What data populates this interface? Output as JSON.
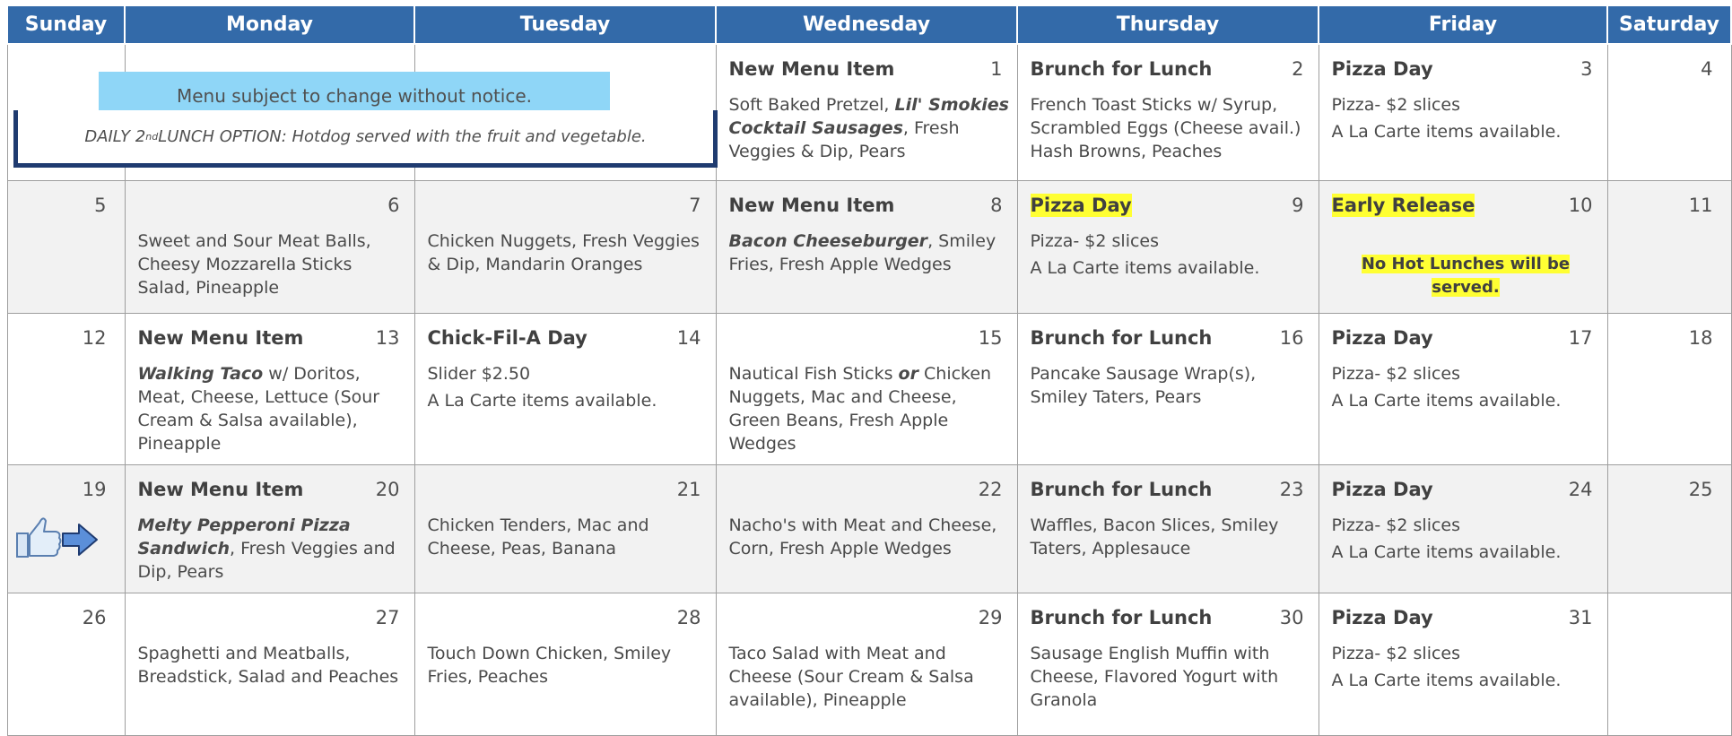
{
  "days": [
    "Sunday",
    "Monday",
    "Tuesday",
    "Wednesday",
    "Thursday",
    "Friday",
    "Saturday"
  ],
  "notice": "Menu subject to change without notice.",
  "daily_option": {
    "prefix": "DAILY 2",
    "sup": "nd",
    "suffix": " LUNCH OPTION: Hotdog served with the fruit and vegetable."
  },
  "icons": {
    "thumb": "thumbs-up-icon",
    "arrow": "right-arrow-icon"
  },
  "colors": {
    "header": "#336aa9",
    "highlight": "#ffff33",
    "notice": "#8fd6f7",
    "frame": "#1f3b70"
  },
  "weeks": [
    {
      "sun": {
        "num": ""
      },
      "mon": {
        "num": ""
      },
      "tue": {
        "num": ""
      },
      "wed": {
        "num": "1",
        "title": "New Menu Item",
        "b1": "Soft Baked Pretzel, ",
        "b2": "Lil' Smokies Cocktail Sausages",
        "b3": ", Fresh Veggies & Dip, Pears"
      },
      "thu": {
        "num": "2",
        "title": "Brunch for Lunch",
        "text": "French Toast Sticks w/ Syrup, Scrambled Eggs (Cheese avail.) Hash Browns, Peaches"
      },
      "fri": {
        "num": "3",
        "title": "Pizza Day",
        "l1": "Pizza- $2 slices",
        "l2": "A La Carte items available."
      },
      "sat": {
        "num": "4"
      }
    },
    {
      "sun": {
        "num": "5"
      },
      "mon": {
        "num": "6",
        "text": "Sweet and Sour Meat Balls, Cheesy Mozzarella Sticks Salad, Pineapple"
      },
      "tue": {
        "num": "7",
        "text": "Chicken Nuggets, Fresh Veggies & Dip, Mandarin Oranges"
      },
      "wed": {
        "num": "8",
        "title": "New Menu Item",
        "b1": "Bacon Cheeseburger",
        "b2": ", Smiley Fries, Fresh Apple Wedges"
      },
      "thu": {
        "num": "9",
        "title": "Pizza Day",
        "l1": "Pizza- $2 slices",
        "l2": "A La Carte items available."
      },
      "fri": {
        "num": "10",
        "title": "Early Release",
        "notice": "No Hot Lunches will be served."
      },
      "sat": {
        "num": "11"
      }
    },
    {
      "sun": {
        "num": "12"
      },
      "mon": {
        "num": "13",
        "title": "New Menu Item",
        "b1": "Walking Taco",
        "b2": " w/ Doritos, Meat, Cheese, Lettuce (Sour Cream & Salsa available), Pineapple"
      },
      "tue": {
        "num": "14",
        "title": "Chick-Fil-A Day",
        "l1": "Slider $2.50",
        "l2": "A La Carte items available."
      },
      "wed": {
        "num": "15",
        "t1": "Nautical Fish Sticks ",
        "or": "or",
        "t2": " Chicken Nuggets, Mac and Cheese, Green Beans, Fresh Apple Wedges"
      },
      "thu": {
        "num": "16",
        "title": "Brunch for Lunch",
        "text": "Pancake Sausage Wrap(s), Smiley Taters, Pears"
      },
      "fri": {
        "num": "17",
        "title": "Pizza Day",
        "l1": "Pizza- $2 slices",
        "l2": "A La Carte items available."
      },
      "sat": {
        "num": "18"
      }
    },
    {
      "sun": {
        "num": "19"
      },
      "mon": {
        "num": "20",
        "title": "New Menu Item",
        "b1": "Melty Pepperoni Pizza Sandwich",
        "b2": ", Fresh Veggies and Dip, Pears"
      },
      "tue": {
        "num": "21",
        "text": "Chicken Tenders, Mac and Cheese, Peas, Banana"
      },
      "wed": {
        "num": "22",
        "text": "Nacho's with Meat and Cheese, Corn, Fresh Apple Wedges"
      },
      "thu": {
        "num": "23",
        "title": "Brunch for Lunch",
        "text": "Waffles, Bacon Slices, Smiley Taters, Applesauce"
      },
      "fri": {
        "num": "24",
        "title": "Pizza Day",
        "l1": "Pizza- $2 slices",
        "l2": "A La Carte items available."
      },
      "sat": {
        "num": "25"
      }
    },
    {
      "sun": {
        "num": "26"
      },
      "mon": {
        "num": "27",
        "text": "Spaghetti and Meatballs, Breadstick, Salad and Peaches"
      },
      "tue": {
        "num": "28",
        "text": "Touch Down Chicken, Smiley Fries, Peaches"
      },
      "wed": {
        "num": "29",
        "text": "Taco Salad with Meat and Cheese (Sour Cream & Salsa available), Pineapple"
      },
      "thu": {
        "num": "30",
        "title": "Brunch for Lunch",
        "text": "Sausage English Muffin with Cheese, Flavored Yogurt with Granola"
      },
      "fri": {
        "num": "31",
        "title": "Pizza Day",
        "l1": "Pizza- $2 slices",
        "l2": "A La Carte items available."
      },
      "sat": {
        "num": ""
      }
    }
  ]
}
